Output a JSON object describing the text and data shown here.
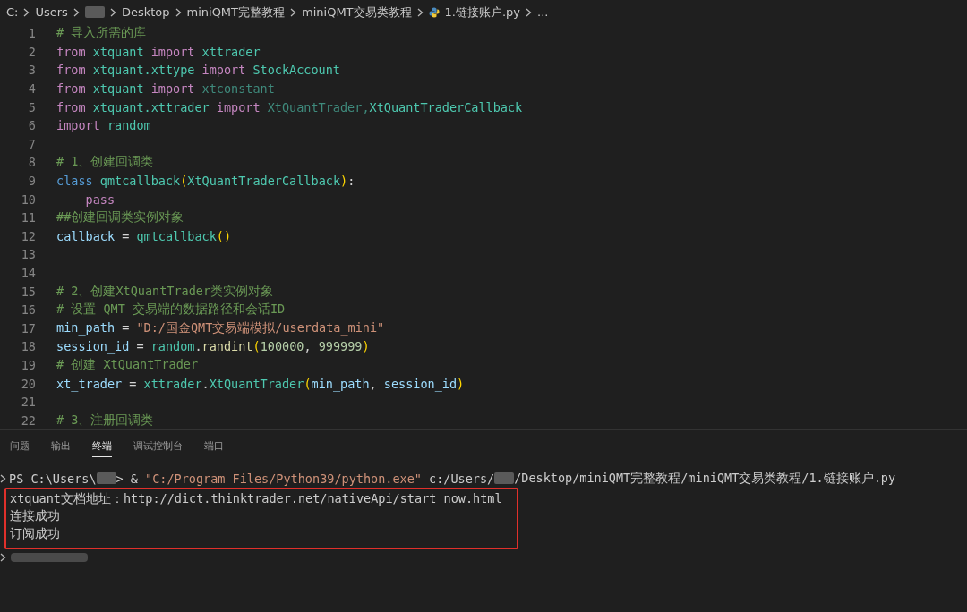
{
  "breadcrumb": [
    {
      "kind": "text",
      "text": "C:"
    },
    {
      "kind": "text",
      "text": "Users"
    },
    {
      "kind": "redacted"
    },
    {
      "kind": "text",
      "text": "Desktop"
    },
    {
      "kind": "text",
      "text": "miniQMT完整教程"
    },
    {
      "kind": "text",
      "text": "miniQMT交易类教程"
    },
    {
      "kind": "file",
      "text": "1.链接账户.py"
    },
    {
      "kind": "text",
      "text": "..."
    }
  ],
  "code_lines": [
    {
      "number": "1",
      "tokens": [
        {
          "kind": "comment",
          "text": "# 导入所需的库"
        }
      ]
    },
    {
      "number": "2",
      "tokens": [
        {
          "kind": "keyword",
          "text": "from "
        },
        {
          "kind": "module",
          "text": "xtquant "
        },
        {
          "kind": "keyword",
          "text": "import "
        },
        {
          "kind": "module",
          "text": "xttrader"
        }
      ]
    },
    {
      "number": "3",
      "tokens": [
        {
          "kind": "keyword",
          "text": "from "
        },
        {
          "kind": "module",
          "text": "xtquant.xttype "
        },
        {
          "kind": "keyword",
          "text": "import "
        },
        {
          "kind": "module",
          "text": "StockAccount"
        }
      ]
    },
    {
      "number": "4",
      "tokens": [
        {
          "kind": "keyword",
          "text": "from "
        },
        {
          "kind": "module",
          "text": "xtquant "
        },
        {
          "kind": "keyword",
          "text": "import "
        },
        {
          "kind": "unused",
          "text": "xtconstant"
        }
      ]
    },
    {
      "number": "5",
      "tokens": [
        {
          "kind": "keyword",
          "text": "from "
        },
        {
          "kind": "module",
          "text": "xtquant.xttrader "
        },
        {
          "kind": "keyword",
          "text": "import "
        },
        {
          "kind": "unused",
          "text": "XtQuantTrader,"
        },
        {
          "kind": "module",
          "text": "XtQuantTraderCallback"
        }
      ]
    },
    {
      "number": "6",
      "tokens": [
        {
          "kind": "keyword",
          "text": "import "
        },
        {
          "kind": "module",
          "text": "random"
        }
      ]
    },
    {
      "number": "7"
    },
    {
      "number": "8",
      "tokens": [
        {
          "kind": "comment",
          "text": "# 1、创建回调类"
        }
      ]
    },
    {
      "number": "9",
      "tokens": [
        {
          "kind": "storage",
          "text": "class "
        },
        {
          "kind": "module",
          "text": "qmtcallback"
        },
        {
          "kind": "paren",
          "text": "("
        },
        {
          "kind": "module",
          "text": "XtQuantTraderCallback"
        },
        {
          "kind": "paren",
          "text": ")"
        },
        {
          "kind": "plain",
          "text": ":"
        }
      ]
    },
    {
      "number": "10",
      "tokens": [
        {
          "kind": "keyword",
          "text": "    pass"
        }
      ]
    },
    {
      "number": "11",
      "tokens": [
        {
          "kind": "comment",
          "text": "##创建回调类实例对象"
        }
      ]
    },
    {
      "number": "12",
      "tokens": [
        {
          "kind": "variable",
          "text": "callback"
        },
        {
          "kind": "plain",
          "text": " = "
        },
        {
          "kind": "module",
          "text": "qmtcallback"
        },
        {
          "kind": "paren",
          "text": "()"
        }
      ]
    },
    {
      "number": "13"
    },
    {
      "number": "14"
    },
    {
      "number": "15",
      "tokens": [
        {
          "kind": "comment",
          "text": "# 2、创建XtQuantTrader类实例对象"
        }
      ]
    },
    {
      "number": "16",
      "tokens": [
        {
          "kind": "comment",
          "text": "# 设置 QMT 交易端的数据路径和会话ID"
        }
      ]
    },
    {
      "number": "17",
      "tokens": [
        {
          "kind": "variable",
          "text": "min_path"
        },
        {
          "kind": "plain",
          "text": " = "
        },
        {
          "kind": "string",
          "text": "\"D:/国金QMT交易端模拟/userdata_mini\""
        }
      ]
    },
    {
      "number": "18",
      "tokens": [
        {
          "kind": "variable",
          "text": "session_id"
        },
        {
          "kind": "plain",
          "text": " = "
        },
        {
          "kind": "module",
          "text": "random"
        },
        {
          "kind": "plain",
          "text": "."
        },
        {
          "kind": "function",
          "text": "randint"
        },
        {
          "kind": "paren",
          "text": "("
        },
        {
          "kind": "number",
          "text": "100000"
        },
        {
          "kind": "plain",
          "text": ", "
        },
        {
          "kind": "number",
          "text": "999999"
        },
        {
          "kind": "paren",
          "text": ")"
        }
      ]
    },
    {
      "number": "19",
      "tokens": [
        {
          "kind": "comment",
          "text": "# 创建 XtQuantTrader"
        }
      ]
    },
    {
      "number": "20",
      "tokens": [
        {
          "kind": "variable",
          "text": "xt_trader"
        },
        {
          "kind": "plain",
          "text": " = "
        },
        {
          "kind": "module",
          "text": "xttrader"
        },
        {
          "kind": "plain",
          "text": "."
        },
        {
          "kind": "module",
          "text": "XtQuantTrader"
        },
        {
          "kind": "paren",
          "text": "("
        },
        {
          "kind": "variable",
          "text": "min_path"
        },
        {
          "kind": "plain",
          "text": ", "
        },
        {
          "kind": "variable",
          "text": "session_id"
        },
        {
          "kind": "paren",
          "text": ")"
        }
      ]
    },
    {
      "number": "21"
    },
    {
      "number": "22",
      "tokens": [
        {
          "kind": "comment",
          "text": "# 3、注册回调类"
        }
      ]
    }
  ],
  "panel_tabs": [
    {
      "label": "问题",
      "selected": false
    },
    {
      "label": "输出",
      "selected": false
    },
    {
      "label": "终端",
      "selected": true
    },
    {
      "label": "调试控制台",
      "selected": false
    },
    {
      "label": "端口",
      "selected": false
    }
  ],
  "terminal": {
    "command": [
      {
        "kind": "text",
        "text": "PS C:\\Users\\"
      },
      {
        "kind": "redacted"
      },
      {
        "kind": "text",
        "text": "> & "
      },
      {
        "kind": "string",
        "text": "\"C:/Program Files/Python39/python.exe\""
      },
      {
        "kind": "text",
        "text": " c:/Users/"
      },
      {
        "kind": "redacted"
      },
      {
        "kind": "text",
        "text": "/Desktop/miniQMT完整教程/miniQMT交易类教程/1.链接账户.py"
      }
    ],
    "output_lines": [
      "xtquant文档地址：http://dict.thinktrader.net/nativeApi/start_now.html",
      "连接成功",
      "订阅成功"
    ]
  }
}
